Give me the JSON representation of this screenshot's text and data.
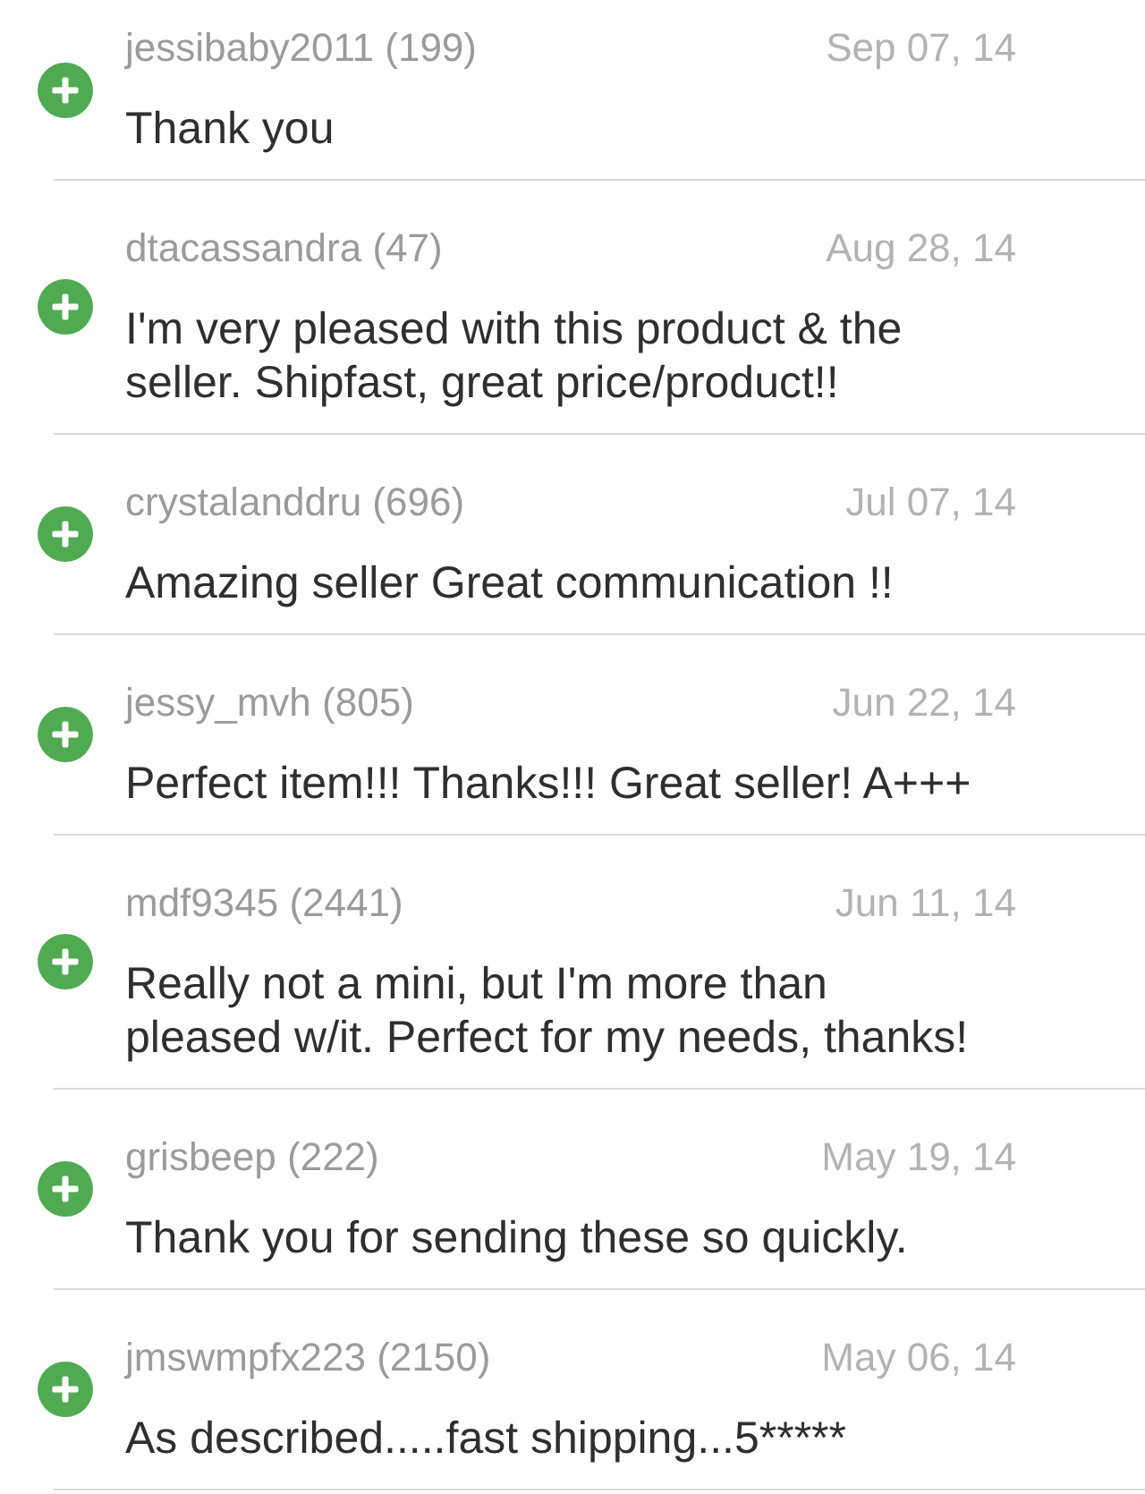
{
  "feedback": [
    {
      "kind": "positive",
      "username": "jessibaby2011 (199)",
      "date": "Sep 07, 14",
      "comment": "Thank you"
    },
    {
      "kind": "positive",
      "username": "dtacassandra (47)",
      "date": "Aug 28, 14",
      "comment": "I'm very pleased with this product & the seller. Shipfast, great price/product!!"
    },
    {
      "kind": "positive",
      "username": "crystalanddru (696)",
      "date": "Jul 07, 14",
      "comment": "Amazing seller Great communication !!"
    },
    {
      "kind": "positive",
      "username": "jessy_mvh (805)",
      "date": "Jun 22, 14",
      "comment": "Perfect item!!! Thanks!!! Great seller! A+++"
    },
    {
      "kind": "positive",
      "username": "mdf9345 (2441)",
      "date": "Jun 11, 14",
      "comment": "Really not a mini, but I'm more than pleased w/it. Perfect for my needs, thanks!"
    },
    {
      "kind": "positive",
      "username": "grisbeep (222)",
      "date": "May 19, 14",
      "comment": "Thank you for sending these so quickly."
    },
    {
      "kind": "positive",
      "username": "jmswmpfx223 (2150)",
      "date": "May 06, 14",
      "comment": "As described.....fast shipping...5*****"
    }
  ]
}
